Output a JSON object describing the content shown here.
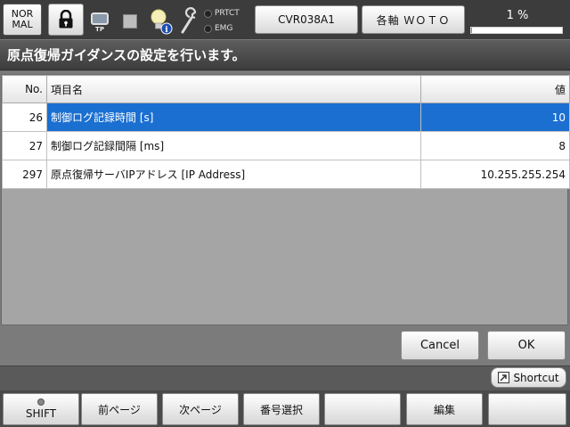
{
  "status_bar": {
    "mode_line1": "NOR",
    "mode_line2": "MAL",
    "tp_label": "TP",
    "prtct_label": "PRTCT",
    "emg_label": "EMG",
    "robot_name": "CVR038A1",
    "axis_label": "各軸 ＷＯＴＯ",
    "progress_text": "1 %",
    "progress_value": 0.01
  },
  "title": "原点復帰ガイダンスの設定を行います。",
  "table": {
    "headers": {
      "no": "No.",
      "name": "項目名",
      "value": "値"
    },
    "rows": [
      {
        "no": "26",
        "name": "制御ログ記録時間 [s]",
        "value": "10"
      },
      {
        "no": "27",
        "name": "制御ログ記録間隔 [ms]",
        "value": "8"
      },
      {
        "no": "297",
        "name": "原点復帰サーバIPアドレス [IP Address]",
        "value": "10.255.255.254"
      }
    ],
    "selected_row": 0
  },
  "dialog_buttons": {
    "cancel": "Cancel",
    "ok": "OK"
  },
  "shortcut_label": "Shortcut",
  "function_keys": {
    "f1": "SHIFT",
    "f2": "前ページ",
    "f3": "次ページ",
    "f4": "番号選択",
    "f5": "",
    "f6": "編集",
    "f7": ""
  },
  "colors": {
    "selection": "#1a6fd1",
    "background": "#6f6f6f",
    "progress": "#3aa0e0"
  },
  "icons": [
    "lock-icon",
    "teach-pendant-icon",
    "stop-icon",
    "bulb-info-icon",
    "wrench-icon",
    "shortcut-icon"
  ]
}
